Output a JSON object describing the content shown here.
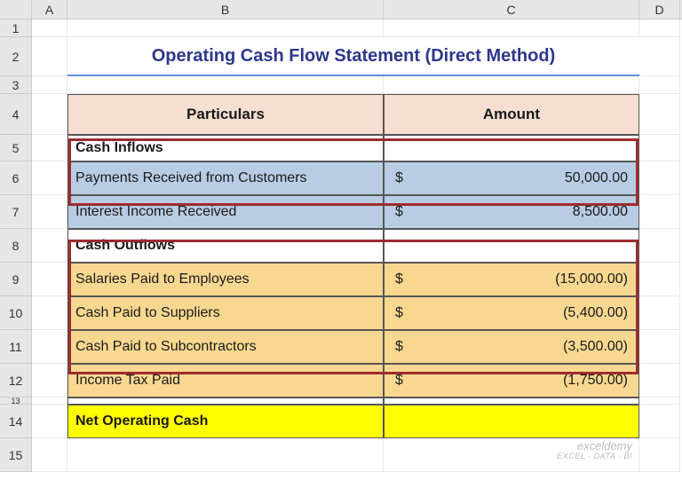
{
  "columns": {
    "A": "A",
    "B": "B",
    "C": "C",
    "D": "D"
  },
  "rows": [
    "1",
    "2",
    "3",
    "4",
    "5",
    "6",
    "7",
    "8",
    "9",
    "10",
    "11",
    "12",
    "13",
    "14",
    "15"
  ],
  "title": "Operating Cash Flow Statement (Direct Method)",
  "headers": {
    "particulars": "Particulars",
    "amount": "Amount"
  },
  "sections": {
    "inflows": "Cash Inflows",
    "outflows": "Cash Outflows",
    "net": "Net Operating Cash"
  },
  "inflows": [
    {
      "label": "Payments Received from Customers",
      "sym": "$",
      "val": "50,000.00"
    },
    {
      "label": "Interest Income Received",
      "sym": "$",
      "val": "8,500.00"
    }
  ],
  "outflows": [
    {
      "label": "Salaries Paid to Employees",
      "sym": "$",
      "val": "(15,000.00)"
    },
    {
      "label": "Cash Paid to Suppliers",
      "sym": "$",
      "val": "(5,400.00)"
    },
    {
      "label": "Cash Paid to Subcontractors",
      "sym": "$",
      "val": "(3,500.00)"
    },
    {
      "label": "Income Tax Paid",
      "sym": "$",
      "val": "(1,750.00)"
    }
  ],
  "watermark": {
    "main": "exceldemy",
    "sub": "EXCEL · DATA · BI"
  },
  "chart_data": {
    "type": "table",
    "title": "Operating Cash Flow Statement (Direct Method)",
    "columns": [
      "Particulars",
      "Amount"
    ],
    "rows": [
      [
        "Cash Inflows",
        ""
      ],
      [
        "Payments Received from Customers",
        50000.0
      ],
      [
        "Interest Income Received",
        8500.0
      ],
      [
        "Cash Outflows",
        ""
      ],
      [
        "Salaries Paid to Employees",
        -15000.0
      ],
      [
        "Cash Paid to Suppliers",
        -5400.0
      ],
      [
        "Cash Paid to Subcontractors",
        -3500.0
      ],
      [
        "Income Tax Paid",
        -1750.0
      ],
      [
        "Net Operating Cash",
        ""
      ]
    ]
  }
}
